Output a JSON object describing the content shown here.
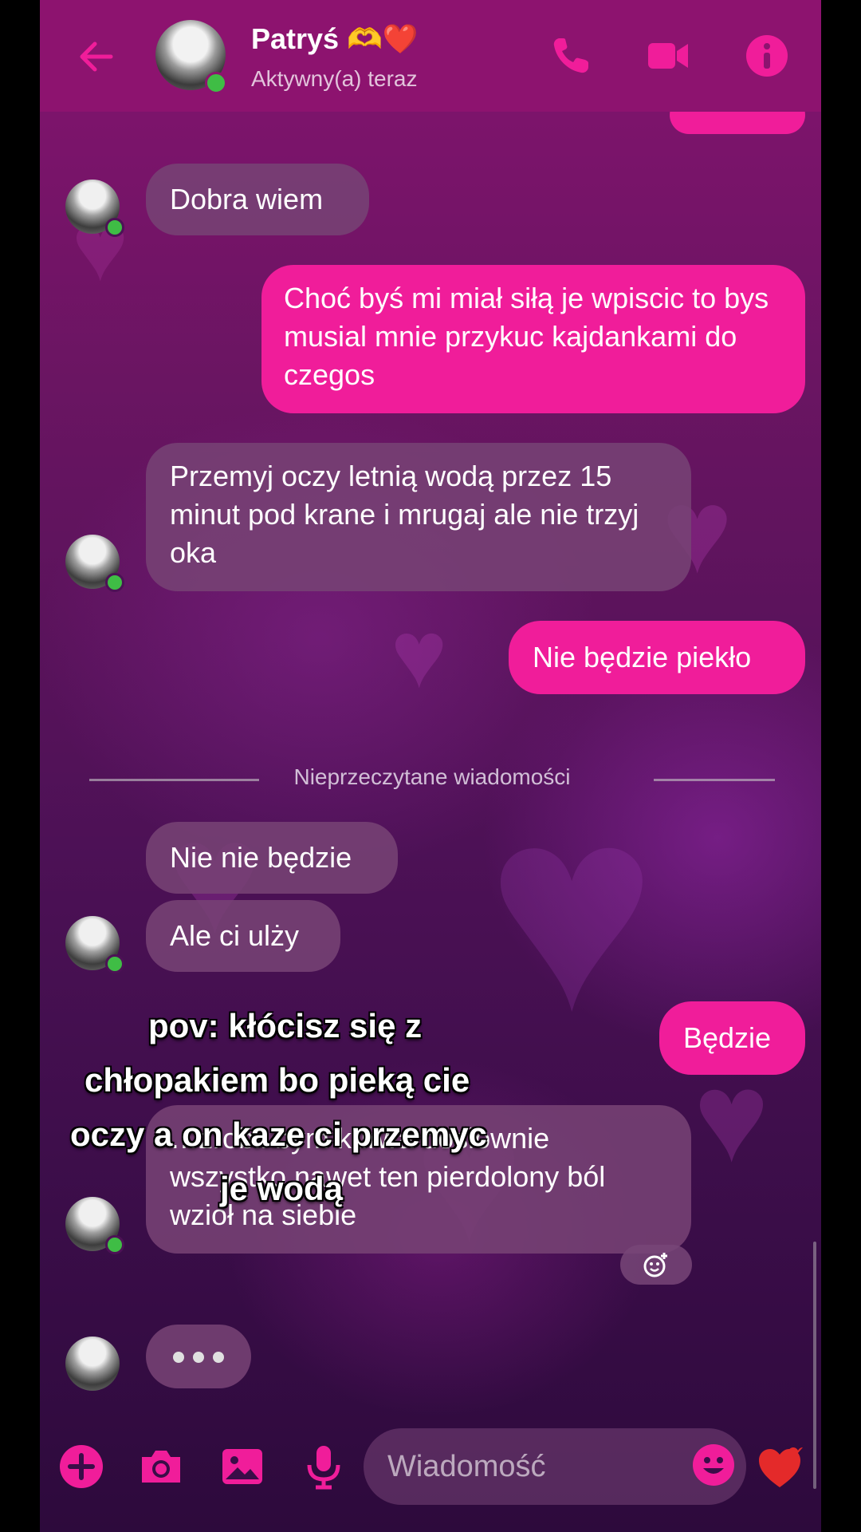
{
  "header": {
    "contact_name": "Patryś 🫶❤️",
    "status": "Aktywny(a) teraz"
  },
  "messages": [
    {
      "dir": "in",
      "text": "Dobra wiem"
    },
    {
      "dir": "out",
      "text": "Choć byś mi miał siłą je wpiscic to bys musial mnie przykuc kajdankami do czegos"
    },
    {
      "dir": "in",
      "text": "Przemyj oczy letnią wodą przez 15 minut pod krane i mrugaj ale nie trzyj oka"
    },
    {
      "dir": "out",
      "text": "Nie będzie piekło"
    },
    {
      "dir": "in",
      "text": "Nie nie będzie"
    },
    {
      "dir": "in",
      "text": "Ale ci ulży"
    },
    {
      "dir": "out",
      "text": "Będzie"
    },
    {
      "dir": "in",
      "text": "…zrobił bym kurwa dosłownie wszystko nawet ten pierdolony ból wzioł na siebie"
    }
  ],
  "divider_label": "Nieprzeczytane wiadomości",
  "caption_lines": [
    "pov: kłócisz się z",
    "chłopakiem bo pieką cie",
    "oczy a on kaze ci przemyc",
    "je wodą"
  ],
  "composer": {
    "placeholder": "Wiadomość"
  },
  "colors": {
    "header": "#8d136f",
    "outgoing_bubble": "#f01d9a",
    "incoming_bubble": "#764274",
    "icon_accent": "#f01d9a",
    "online_dot": "#3fbd45"
  },
  "icons": [
    "back-arrow-icon",
    "phone-icon",
    "video-camera-icon",
    "info-icon",
    "add-icon",
    "camera-icon",
    "gallery-icon",
    "microphone-icon",
    "emoji-icon",
    "heart-icon",
    "add-reaction-icon"
  ]
}
